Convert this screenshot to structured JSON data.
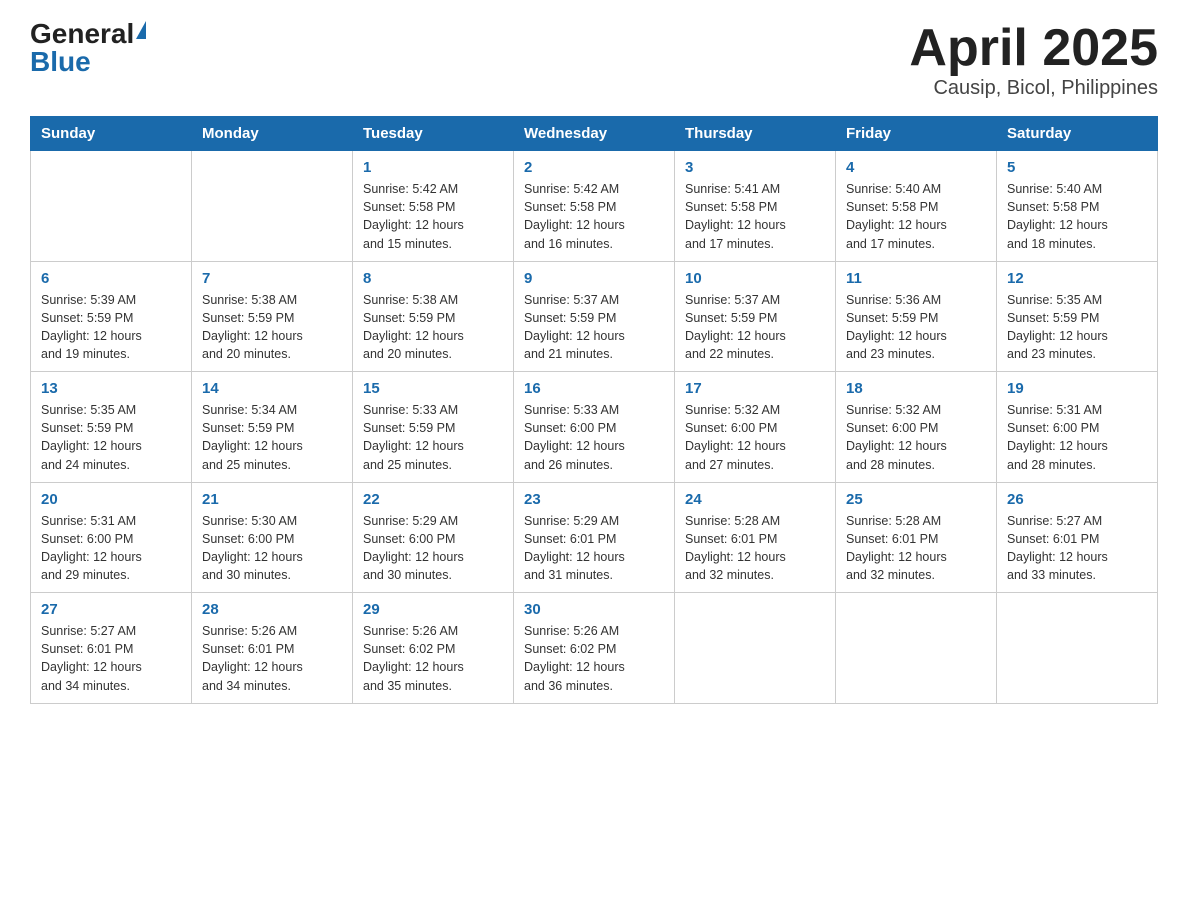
{
  "header": {
    "logo_general": "General",
    "logo_blue": "Blue",
    "title": "April 2025",
    "subtitle": "Causip, Bicol, Philippines"
  },
  "calendar": {
    "days_of_week": [
      "Sunday",
      "Monday",
      "Tuesday",
      "Wednesday",
      "Thursday",
      "Friday",
      "Saturday"
    ],
    "weeks": [
      [
        {
          "day": "",
          "info": ""
        },
        {
          "day": "",
          "info": ""
        },
        {
          "day": "1",
          "info": "Sunrise: 5:42 AM\nSunset: 5:58 PM\nDaylight: 12 hours\nand 15 minutes."
        },
        {
          "day": "2",
          "info": "Sunrise: 5:42 AM\nSunset: 5:58 PM\nDaylight: 12 hours\nand 16 minutes."
        },
        {
          "day": "3",
          "info": "Sunrise: 5:41 AM\nSunset: 5:58 PM\nDaylight: 12 hours\nand 17 minutes."
        },
        {
          "day": "4",
          "info": "Sunrise: 5:40 AM\nSunset: 5:58 PM\nDaylight: 12 hours\nand 17 minutes."
        },
        {
          "day": "5",
          "info": "Sunrise: 5:40 AM\nSunset: 5:58 PM\nDaylight: 12 hours\nand 18 minutes."
        }
      ],
      [
        {
          "day": "6",
          "info": "Sunrise: 5:39 AM\nSunset: 5:59 PM\nDaylight: 12 hours\nand 19 minutes."
        },
        {
          "day": "7",
          "info": "Sunrise: 5:38 AM\nSunset: 5:59 PM\nDaylight: 12 hours\nand 20 minutes."
        },
        {
          "day": "8",
          "info": "Sunrise: 5:38 AM\nSunset: 5:59 PM\nDaylight: 12 hours\nand 20 minutes."
        },
        {
          "day": "9",
          "info": "Sunrise: 5:37 AM\nSunset: 5:59 PM\nDaylight: 12 hours\nand 21 minutes."
        },
        {
          "day": "10",
          "info": "Sunrise: 5:37 AM\nSunset: 5:59 PM\nDaylight: 12 hours\nand 22 minutes."
        },
        {
          "day": "11",
          "info": "Sunrise: 5:36 AM\nSunset: 5:59 PM\nDaylight: 12 hours\nand 23 minutes."
        },
        {
          "day": "12",
          "info": "Sunrise: 5:35 AM\nSunset: 5:59 PM\nDaylight: 12 hours\nand 23 minutes."
        }
      ],
      [
        {
          "day": "13",
          "info": "Sunrise: 5:35 AM\nSunset: 5:59 PM\nDaylight: 12 hours\nand 24 minutes."
        },
        {
          "day": "14",
          "info": "Sunrise: 5:34 AM\nSunset: 5:59 PM\nDaylight: 12 hours\nand 25 minutes."
        },
        {
          "day": "15",
          "info": "Sunrise: 5:33 AM\nSunset: 5:59 PM\nDaylight: 12 hours\nand 25 minutes."
        },
        {
          "day": "16",
          "info": "Sunrise: 5:33 AM\nSunset: 6:00 PM\nDaylight: 12 hours\nand 26 minutes."
        },
        {
          "day": "17",
          "info": "Sunrise: 5:32 AM\nSunset: 6:00 PM\nDaylight: 12 hours\nand 27 minutes."
        },
        {
          "day": "18",
          "info": "Sunrise: 5:32 AM\nSunset: 6:00 PM\nDaylight: 12 hours\nand 28 minutes."
        },
        {
          "day": "19",
          "info": "Sunrise: 5:31 AM\nSunset: 6:00 PM\nDaylight: 12 hours\nand 28 minutes."
        }
      ],
      [
        {
          "day": "20",
          "info": "Sunrise: 5:31 AM\nSunset: 6:00 PM\nDaylight: 12 hours\nand 29 minutes."
        },
        {
          "day": "21",
          "info": "Sunrise: 5:30 AM\nSunset: 6:00 PM\nDaylight: 12 hours\nand 30 minutes."
        },
        {
          "day": "22",
          "info": "Sunrise: 5:29 AM\nSunset: 6:00 PM\nDaylight: 12 hours\nand 30 minutes."
        },
        {
          "day": "23",
          "info": "Sunrise: 5:29 AM\nSunset: 6:01 PM\nDaylight: 12 hours\nand 31 minutes."
        },
        {
          "day": "24",
          "info": "Sunrise: 5:28 AM\nSunset: 6:01 PM\nDaylight: 12 hours\nand 32 minutes."
        },
        {
          "day": "25",
          "info": "Sunrise: 5:28 AM\nSunset: 6:01 PM\nDaylight: 12 hours\nand 32 minutes."
        },
        {
          "day": "26",
          "info": "Sunrise: 5:27 AM\nSunset: 6:01 PM\nDaylight: 12 hours\nand 33 minutes."
        }
      ],
      [
        {
          "day": "27",
          "info": "Sunrise: 5:27 AM\nSunset: 6:01 PM\nDaylight: 12 hours\nand 34 minutes."
        },
        {
          "day": "28",
          "info": "Sunrise: 5:26 AM\nSunset: 6:01 PM\nDaylight: 12 hours\nand 34 minutes."
        },
        {
          "day": "29",
          "info": "Sunrise: 5:26 AM\nSunset: 6:02 PM\nDaylight: 12 hours\nand 35 minutes."
        },
        {
          "day": "30",
          "info": "Sunrise: 5:26 AM\nSunset: 6:02 PM\nDaylight: 12 hours\nand 36 minutes."
        },
        {
          "day": "",
          "info": ""
        },
        {
          "day": "",
          "info": ""
        },
        {
          "day": "",
          "info": ""
        }
      ]
    ]
  }
}
